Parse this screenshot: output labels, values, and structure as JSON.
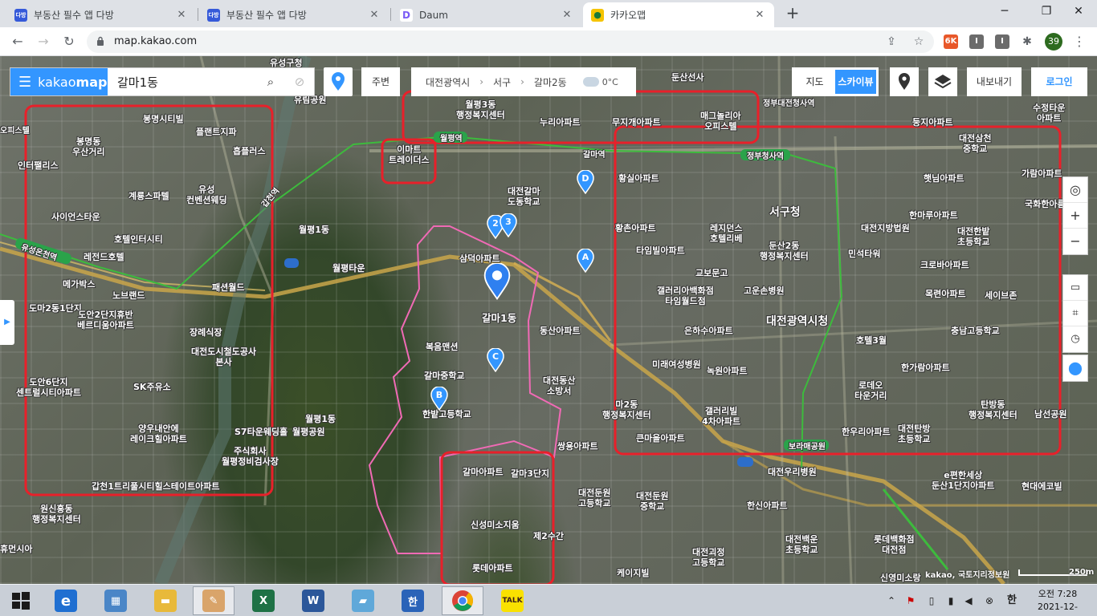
{
  "browser": {
    "tabs": [
      {
        "title": "부동산 필수 앱 다방",
        "favicon": "dabang-icon",
        "color": "#3559d9"
      },
      {
        "title": "부동산 필수 앱 다방",
        "favicon": "dabang-icon",
        "color": "#3559d9"
      },
      {
        "title": "Daum",
        "favicon": "daum-icon",
        "color": "#7b5cf5"
      },
      {
        "title": "카카오맵",
        "favicon": "kakaomap-icon",
        "color": "#f5c400"
      }
    ],
    "url": "map.kakao.com",
    "profile_badge": "39",
    "ext_labels": [
      "6K",
      "I",
      "I"
    ]
  },
  "kakaomap": {
    "logo_text": "kakao",
    "logo_bold": "map",
    "search_value": "갈마1동",
    "nearby_label": "주변",
    "region": [
      "대전광역시",
      "서구",
      "갈마2동"
    ],
    "weather_temp": "0°C",
    "maptype": {
      "map": "지도",
      "sky": "스카이뷰"
    },
    "export_label": "내보내기",
    "login_label": "로그인",
    "copyright": "kakao, 국토지리정보원",
    "scale": "250m",
    "accent_color": "#3396ff",
    "highlight_color": "#e8202a",
    "boundary_color": "#f06ab5"
  },
  "map_labels": [
    "유성구청",
    "유림공원",
    "월평3동",
    "행정복지센터",
    "누리아파트",
    "무지개아파트",
    "매그놀리아",
    "오피스텔",
    "수정타운",
    "아파트",
    "둥지아파트",
    "대전삼천",
    "중학교",
    "봉명시티빌",
    "플랜트지파",
    "봉명동",
    "우산거리",
    "인터팰리스",
    "흡플러스",
    "유성",
    "컨벤션웨딩",
    "계룡스파텔",
    "사이언스타운",
    "호텔인터시티",
    "레전드호텔",
    "메가박스",
    "노브랜드",
    "패션월드",
    "도마2동1단지",
    "도안2단지휴반",
    "베르디움아파트",
    "장례식장",
    "대전도시철도공사",
    "본사",
    "도안6단지",
    "센트럴시티아파트",
    "SK주유소",
    "양우내안에",
    "레이크힐아파트",
    "S7타운웨딩홀",
    "주식회사",
    "월평정비검사장",
    "갑천1트리풀시티힐스테이트아파트",
    "원신흥동",
    "행정복지센터",
    "휴먼시아",
    "이마트",
    "트레이더스",
    "월평1동",
    "대전갈마",
    "도동학교",
    "월평타운",
    "삼덕아파트",
    "갈마1동",
    "동산아파트",
    "복음맨션",
    "갈마중학교",
    "한밭고등학교",
    "월평1동",
    "월평공원",
    "갈마아파트",
    "갈마3단지",
    "신성미소지움",
    "제2수간",
    "롯데아파트",
    "쌍용아파트",
    "대전둔원",
    "고등학교",
    "대전동산",
    "소방서",
    "마2동",
    "행정복지센터",
    "정부청사역",
    "갈마역",
    "월평역",
    "갑천역",
    "유성온천역",
    "황실아파트",
    "서구청",
    "둔산2동",
    "레지던스",
    "호텔리베",
    "교보문고",
    "황촌아파트",
    "타임빌아파트",
    "갤러리아백화점",
    "타임월드점",
    "고운손병원",
    "대전광역시청",
    "은하수아파트",
    "미래여성병원",
    "녹원아파트",
    "갤러리빌",
    "4차아파트",
    "큰마을아파트",
    "호텔3월",
    "로데오",
    "타운거리",
    "한가람아파트",
    "목련아파트",
    "충남고등학교",
    "탄방동",
    "행정복지센터",
    "한우리아파트",
    "대전탄방",
    "초등학교",
    "보라매공원",
    "햇님아파트",
    "가람아파트",
    "한마루아파트",
    "대전지방법원",
    "크로바아파트",
    "세이브존",
    "대전한밭",
    "초등학교",
    "민석타워",
    "국화한아름",
    "정부대전청사역",
    "둔산선사",
    "대전우리병원",
    "한신아파트",
    "대전둔원",
    "중학교",
    "대전백운",
    "초등학교",
    "대전괴정",
    "고등학교",
    "롯데백화점",
    "대전점",
    "케이지빌",
    "신영미소랑",
    "e편한세상",
    "둔산1단지아파트",
    "현대에코빌",
    "남선공원",
    "오피스텔"
  ],
  "taskbar": {
    "clock_time": "오전 7:28",
    "clock_date": "2021-12-24",
    "ime": "한"
  }
}
